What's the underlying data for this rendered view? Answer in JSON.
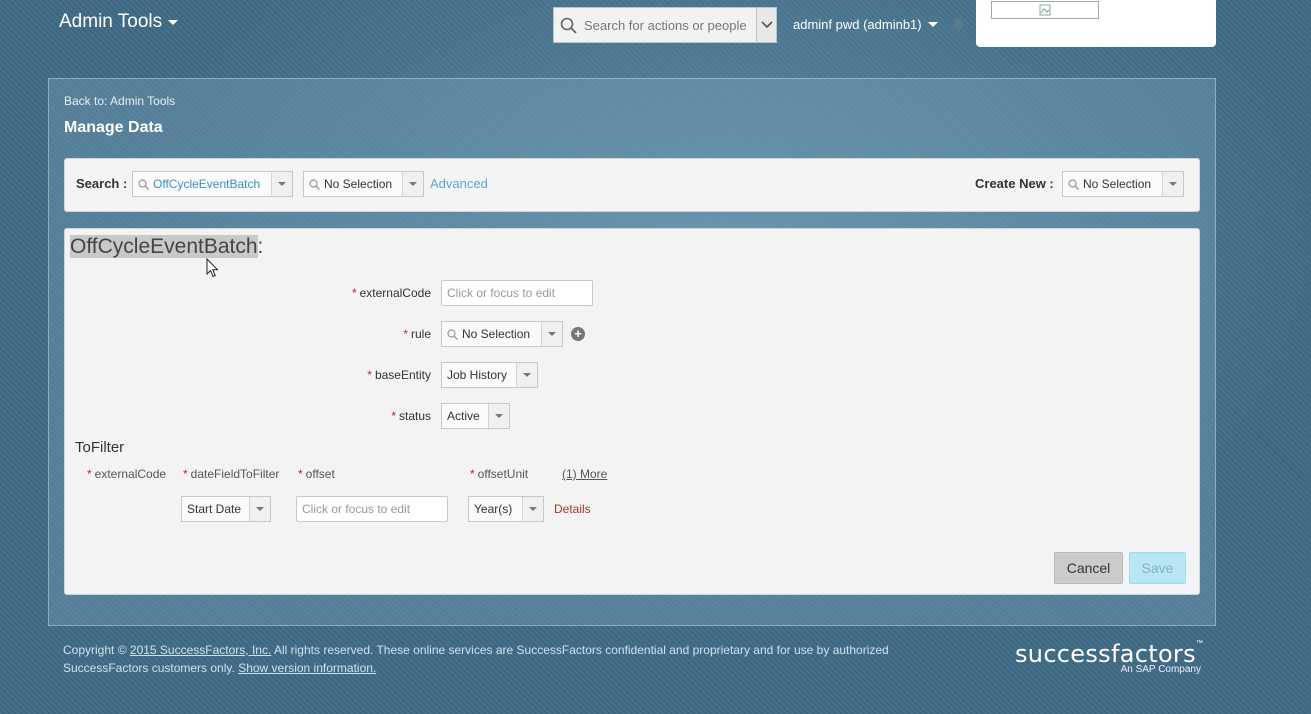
{
  "header": {
    "app_title": "Admin Tools",
    "search_placeholder": "Search for actions or people",
    "user_label": "adminf pwd (adminb1)"
  },
  "breadcrumb": {
    "back_label": "Back to: Admin Tools"
  },
  "page_title": "Manage Data",
  "search_bar": {
    "search_label": "Search :",
    "object_type_value": "OffCycleEventBatch",
    "object_value": "No Selection",
    "advanced_label": "Advanced",
    "create_new_label": "Create New :",
    "create_new_value": "No Selection"
  },
  "form": {
    "object_name": "OffCycleEventBatch",
    "title_suffix": ":",
    "required_marker": "*",
    "fields": {
      "external_code_label": "externalCode",
      "external_code_placeholder": "Click or focus to edit",
      "rule_label": "rule",
      "rule_value": "No Selection",
      "base_entity_label": "baseEntity",
      "base_entity_value": "Job History",
      "status_label": "status",
      "status_value": "Active"
    },
    "to_filter": {
      "section_title": "ToFilter",
      "columns": {
        "external_code": "externalCode",
        "date_field": "dateFieldToFilter",
        "offset": "offset",
        "offset_unit": "offsetUnit"
      },
      "more_link": "(1) More",
      "row": {
        "date_field_value": "Start Date",
        "offset_placeholder": "Click or focus to edit",
        "offset_unit_value": "Year(s)",
        "details_link": "Details"
      }
    },
    "buttons": {
      "cancel": "Cancel",
      "save": "Save"
    }
  },
  "footer": {
    "copyright_prefix": "Copyright ©",
    "company_link": "2015 SuccessFactors, Inc.",
    "copyright_body": " All rights reserved. These online services are SuccessFactors confidential and proprietary and for use by authorized SuccessFactors customers only.",
    "version_link": "Show version information."
  },
  "brand": {
    "name": "successfactors",
    "trademark": "™",
    "tagline": "An SAP Company"
  },
  "icons": [
    "chevron-down-icon",
    "search-icon",
    "bell-icon",
    "add-circle-icon",
    "mouse-cursor-icon"
  ],
  "colors": {
    "link_blue": "#5aa8d6",
    "required_red": "#c0262d",
    "save_button": "#b9e6f4",
    "details_link": "#a33a2a"
  }
}
